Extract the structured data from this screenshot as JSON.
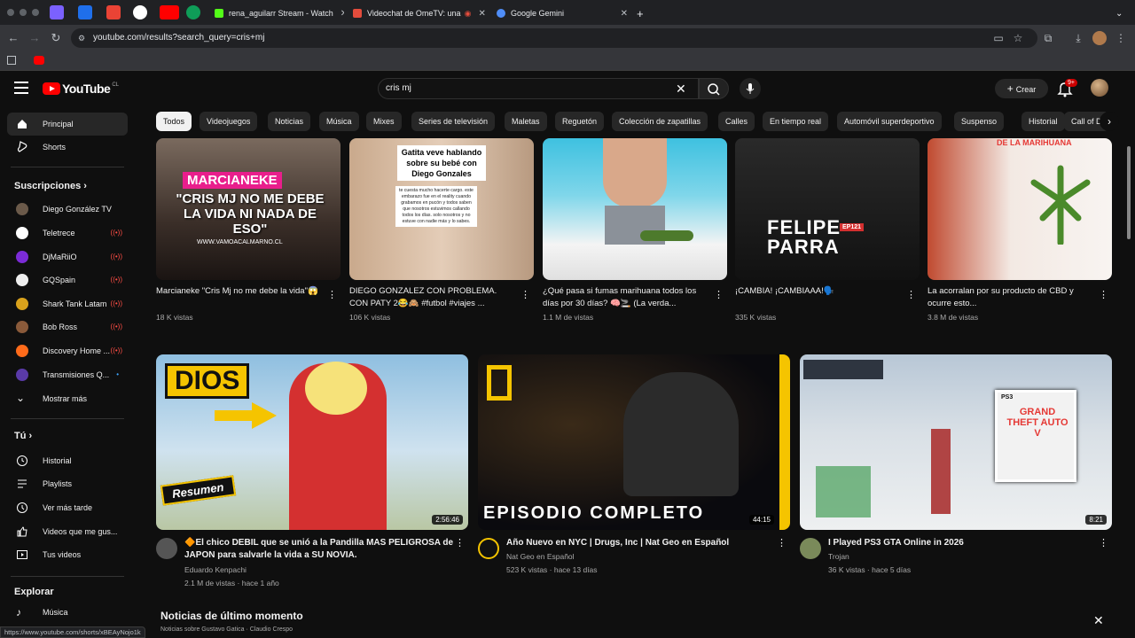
{
  "browser": {
    "tabs": [
      {
        "label": "rena_aguilarr Stream - Watch",
        "favicon_color": "#53fc18"
      },
      {
        "label": "Videochat de OmeTV: una",
        "favicon_color": "#e34c3c"
      },
      {
        "label": "Google Gemini",
        "favicon_color": "#4f8df7"
      }
    ],
    "new_tab": "+",
    "url": "youtube.com/results?search_query=cris+mj",
    "status_url": "https://www.youtube.com/shorts/xBEAyNojo1k"
  },
  "yt": {
    "logo_text": "YouTube",
    "country": "CL",
    "search_value": "cris mj",
    "create_label": "Crear",
    "notif_badge": "9+",
    "brand_color": "#ff0000"
  },
  "sidebar": {
    "main": [
      {
        "label": "Principal",
        "icon": "home-icon",
        "active": true
      },
      {
        "label": "Shorts",
        "icon": "shorts-icon"
      }
    ],
    "subs_heading": "Suscripciones",
    "subs": [
      {
        "label": "Diego González TV",
        "color": "#6b5a4a",
        "live": false
      },
      {
        "label": "Teletrece",
        "color": "#ffffff",
        "live": true
      },
      {
        "label": "DjMaRiiO",
        "color": "#7b2bd6",
        "live": true
      },
      {
        "label": "GQSpain",
        "color": "#eeeeee",
        "live": true
      },
      {
        "label": "Shark Tank Latam",
        "color": "#d9a21c",
        "live": true
      },
      {
        "label": "Bob Ross",
        "color": "#8a5a3a",
        "live": true
      },
      {
        "label": "Discovery Home ...",
        "color": "#ff6b1a",
        "live": true
      },
      {
        "label": "Transmisiones Q...",
        "color": "#5a3aa8",
        "live": false,
        "dot": true
      }
    ],
    "show_more": "Mostrar más",
    "you_heading": "Tú",
    "you": [
      {
        "label": "Historial",
        "icon": "history-icon"
      },
      {
        "label": "Playlists",
        "icon": "playlists-icon"
      },
      {
        "label": "Ver más tarde",
        "icon": "watch-later-icon"
      },
      {
        "label": "Videos que me gus...",
        "icon": "like-icon"
      },
      {
        "label": "Tus videos",
        "icon": "your-videos-icon"
      }
    ],
    "explore_heading": "Explorar",
    "explore": [
      {
        "label": "Música",
        "icon": "music-icon"
      }
    ]
  },
  "chips": [
    "Todos",
    "Videojuegos",
    "Noticias",
    "Música",
    "Mixes",
    "Series de televisión",
    "Maletas",
    "Reguetón",
    "Colección de zapatillas",
    "Calles",
    "En tiempo real",
    "Automóvil superdeportivo",
    "Suspenso",
    "Historial",
    "Call of D"
  ],
  "shorts": [
    {
      "title": "Marcianeke \"Cris Mj no me debe la vida\"😱",
      "views": "18 K vistas",
      "thumb_text": "MARCIANEKE\n\"CRIS MJ NO ME DEBE LA VIDA NI NADA DE ESO\"",
      "thumb_sub": "WWW.VAMOACALMARNO.CL"
    },
    {
      "title": "DIEGO GONZALEZ CON PROBLEMA. CON PATY 2😂🙈 #futbol #viajes ...",
      "views": "106 K vistas",
      "thumb_text": "Gatita veve hablando sobre su bebé con Diego Gonzales",
      "thumb_sub": "te cuesta mucho hacerte cargo. este embarazo fue en el reality cuando grabamos en pucón y todos saben que nosotros estuvimos callando todos los días. solo nosotros y no estuve con nadie más y lo sabes."
    },
    {
      "title": "¿Qué pasa si fumas marihuana todos los días por 30 días? 🧠🚬 (La verda...",
      "views": "1.1 M de vistas",
      "thumb_text": "",
      "thumb_sub": ""
    },
    {
      "title": "¡CAMBIA! ¡CAMBIAAA!🗣️",
      "views": "335 K vistas",
      "thumb_text": "FELIPE PARRA",
      "thumb_sub": "EP121"
    },
    {
      "title": "La acorralan por su producto de CBD y ocurre esto...",
      "views": "3.8 M de vistas",
      "thumb_text": "DE LA MARIHUANA",
      "thumb_sub": ""
    }
  ],
  "videos": [
    {
      "title": "🔶El chico DEBIL que se unió a la Pandilla MAS PELIGROSA de JAPON para salvarle la vida a SU NOVIA.",
      "channel": "Eduardo Kenpachi",
      "meta": "2.1 M de vistas · hace 1 año",
      "duration": "2:56:46",
      "thumb_text": "DIOS",
      "thumb_sub": "Resumen"
    },
    {
      "title": "Año Nuevo en NYC | Drugs, Inc | Nat Geo en Español",
      "channel": "Nat Geo en Español",
      "meta": "523 K vistas · hace 13 días",
      "duration": "44:15",
      "thumb_text": "EPISODIO COMPLETO",
      "thumb_sub": ""
    },
    {
      "title": "I Played PS3 GTA Online in 2026",
      "channel": "Trojan",
      "meta": "36 K vistas · hace 5 días",
      "duration": "8:21",
      "thumb_text": "GRAND THEFT AUTO V",
      "thumb_sub": "PS3"
    }
  ],
  "news": {
    "heading": "Noticias de último momento",
    "sub": "Noticias sobre Gustavo Gatica · Claudio Crespo"
  }
}
